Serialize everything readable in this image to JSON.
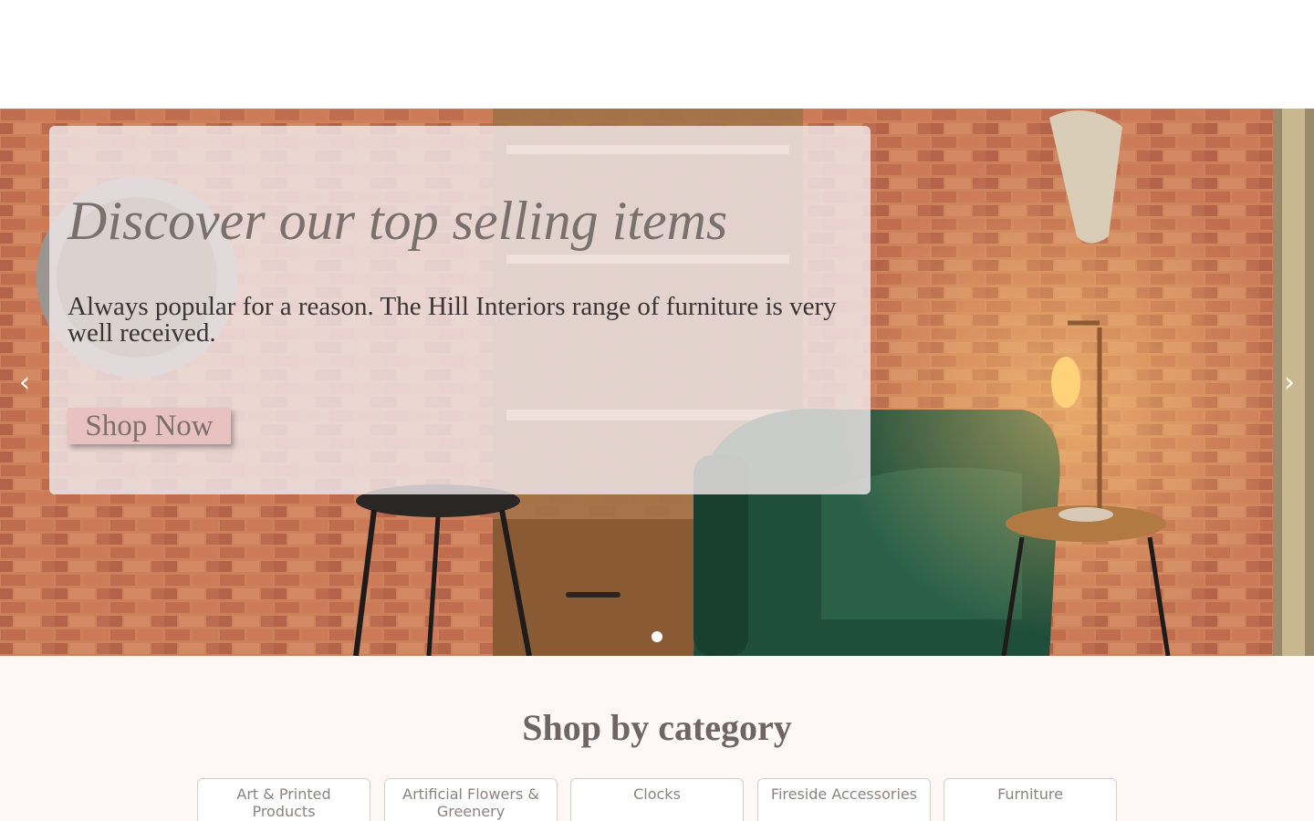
{
  "hero": {
    "title": "Discover our top selling items",
    "text": "Always popular for a reason. The Hill Interiors range of furniture is very well received.",
    "button_label": "Shop Now",
    "prev_icon": "chevron-left-icon",
    "next_icon": "chevron-right-icon",
    "prev_glyph": "‹",
    "next_glyph": "›",
    "slide_count": 1,
    "active_slide": 1
  },
  "categories_section": {
    "title": "Shop by category",
    "items": [
      {
        "label": "Art & Printed Products"
      },
      {
        "label": "Artificial Flowers & Greenery"
      },
      {
        "label": "Clocks"
      },
      {
        "label": "Fireside Accessories"
      },
      {
        "label": "Furniture"
      }
    ]
  },
  "colors": {
    "page_background": "#fdf8f6",
    "header_background": "#ffffff",
    "button_background": "#e8c2c0",
    "heading_text": "#7a716f"
  }
}
